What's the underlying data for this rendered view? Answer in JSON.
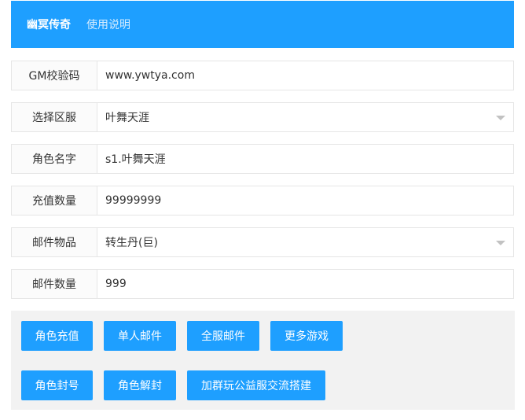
{
  "header": {
    "brand": "幽冥传奇",
    "nav_link": "使用说明"
  },
  "colors": {
    "primary": "#1e9fff",
    "panel_bg": "#f2f2f2",
    "border": "#e6e6e6"
  },
  "form": {
    "gm_code": {
      "label": "GM校验码",
      "value": "www.ywtya.com"
    },
    "server": {
      "label": "选择区服",
      "value": "叶舞天涯"
    },
    "role_name": {
      "label": "角色名字",
      "value": "s1.叶舞天涯"
    },
    "recharge_amount": {
      "label": "充值数量",
      "value": "99999999"
    },
    "mail_item": {
      "label": "邮件物品",
      "value": "转生丹(巨)"
    },
    "mail_quantity": {
      "label": "邮件数量",
      "value": "999"
    }
  },
  "buttons": {
    "role_recharge": "角色充值",
    "single_mail": "单人邮件",
    "all_server_mail": "全服邮件",
    "more_games": "更多游戏",
    "ban_role": "角色封号",
    "unban_role": "角色解封",
    "join_group": "加群玩公益服交流搭建"
  }
}
